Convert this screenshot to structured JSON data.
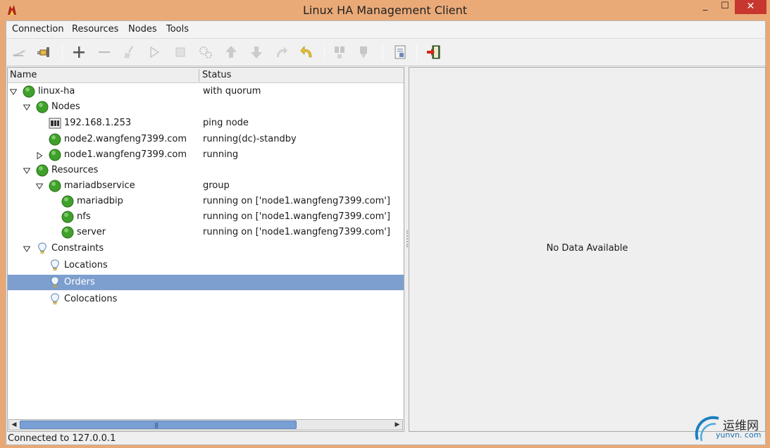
{
  "window": {
    "title": "Linux HA Management Client",
    "minimize": "_",
    "maximize": "☐",
    "close": "✕"
  },
  "menu": [
    "Connection",
    "Resources",
    "Nodes",
    "Tools"
  ],
  "toolbar": {
    "icons": [
      "disconnect-icon",
      "connect-icon",
      "add-icon",
      "remove-icon",
      "cleanup-icon",
      "start-icon",
      "stop-icon",
      "default-icon",
      "move-up-icon",
      "move-down-icon",
      "redo-icon",
      "undo-icon",
      "standby-icon",
      "active-icon",
      "view-xml-icon",
      "exit-icon"
    ]
  },
  "tree": {
    "columns": {
      "name": "Name",
      "status": "Status"
    },
    "rows": [
      {
        "name": "linux-ha",
        "status": "with quorum",
        "level": 0,
        "expand": "open",
        "icon": "green-status-icon"
      },
      {
        "name": "Nodes",
        "status": "",
        "level": 1,
        "expand": "open",
        "icon": "green-status-icon"
      },
      {
        "name": "192.168.1.253",
        "status": "ping node",
        "level": 2,
        "expand": "none",
        "icon": "ping-node-icon"
      },
      {
        "name": "node2.wangfeng7399.com",
        "status": "running(dc)-standby",
        "level": 2,
        "expand": "none",
        "icon": "green-status-icon"
      },
      {
        "name": "node1.wangfeng7399.com",
        "status": "running",
        "level": 2,
        "expand": "closed",
        "icon": "green-status-icon"
      },
      {
        "name": "Resources",
        "status": "",
        "level": 1,
        "expand": "open",
        "icon": "green-status-icon"
      },
      {
        "name": "mariadbservice",
        "status": "group",
        "level": 2,
        "expand": "open",
        "icon": "green-status-icon"
      },
      {
        "name": "mariadbip",
        "status": "running on ['node1.wangfeng7399.com']",
        "level": 3,
        "expand": "none",
        "icon": "green-status-icon"
      },
      {
        "name": "nfs",
        "status": "running on ['node1.wangfeng7399.com']",
        "level": 3,
        "expand": "none",
        "icon": "green-status-icon"
      },
      {
        "name": "server",
        "status": "running on ['node1.wangfeng7399.com']",
        "level": 3,
        "expand": "none",
        "icon": "green-status-icon"
      },
      {
        "name": "Constraints",
        "status": "",
        "level": 1,
        "expand": "open",
        "icon": "lightbulb-icon"
      },
      {
        "name": "Locations",
        "status": "",
        "level": 2,
        "expand": "none",
        "icon": "lightbulb-icon"
      },
      {
        "name": "Orders",
        "status": "",
        "level": 2,
        "expand": "none",
        "icon": "lightbulb-icon",
        "selected": true
      },
      {
        "name": "Colocations",
        "status": "",
        "level": 2,
        "expand": "none",
        "icon": "lightbulb-icon"
      }
    ]
  },
  "detail": {
    "message": "No Data Available"
  },
  "statusbar": {
    "text": "Connected to 127.0.0.1"
  },
  "watermark": {
    "line1": "运维网",
    "line2": "yunvn. com"
  },
  "colors": {
    "selection": "#7d9fcf",
    "titlebar": "#eaaa78",
    "status_green": "#3fa02a",
    "scroll_thumb": "#7a9fd5"
  }
}
